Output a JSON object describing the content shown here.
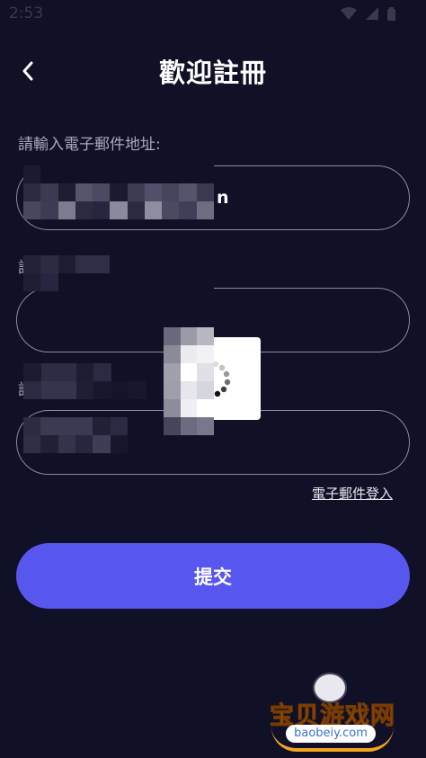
{
  "status_bar": {
    "time": "2:53",
    "battery_icon": "battery-icon",
    "wifi_icon": "wifi-icon",
    "signal_icon": "signal-icon"
  },
  "header": {
    "title": "歡迎註冊",
    "back_icon": "chevron-left-icon"
  },
  "form": {
    "email": {
      "label": "請輸入電子郵件地址:",
      "value_tail": "n"
    },
    "field2": {
      "label_start": "請"
    },
    "field3": {
      "label_start": "請"
    },
    "email_login_link": "電子郵件登入",
    "submit_label": "提交"
  },
  "watermark": {
    "text": "宝贝游戏网",
    "domain": "baobeiy.com"
  },
  "colors": {
    "background": "#101027",
    "accent": "#5757ef",
    "field_border": "#8a8aa3",
    "label": "#a9a9bb"
  }
}
